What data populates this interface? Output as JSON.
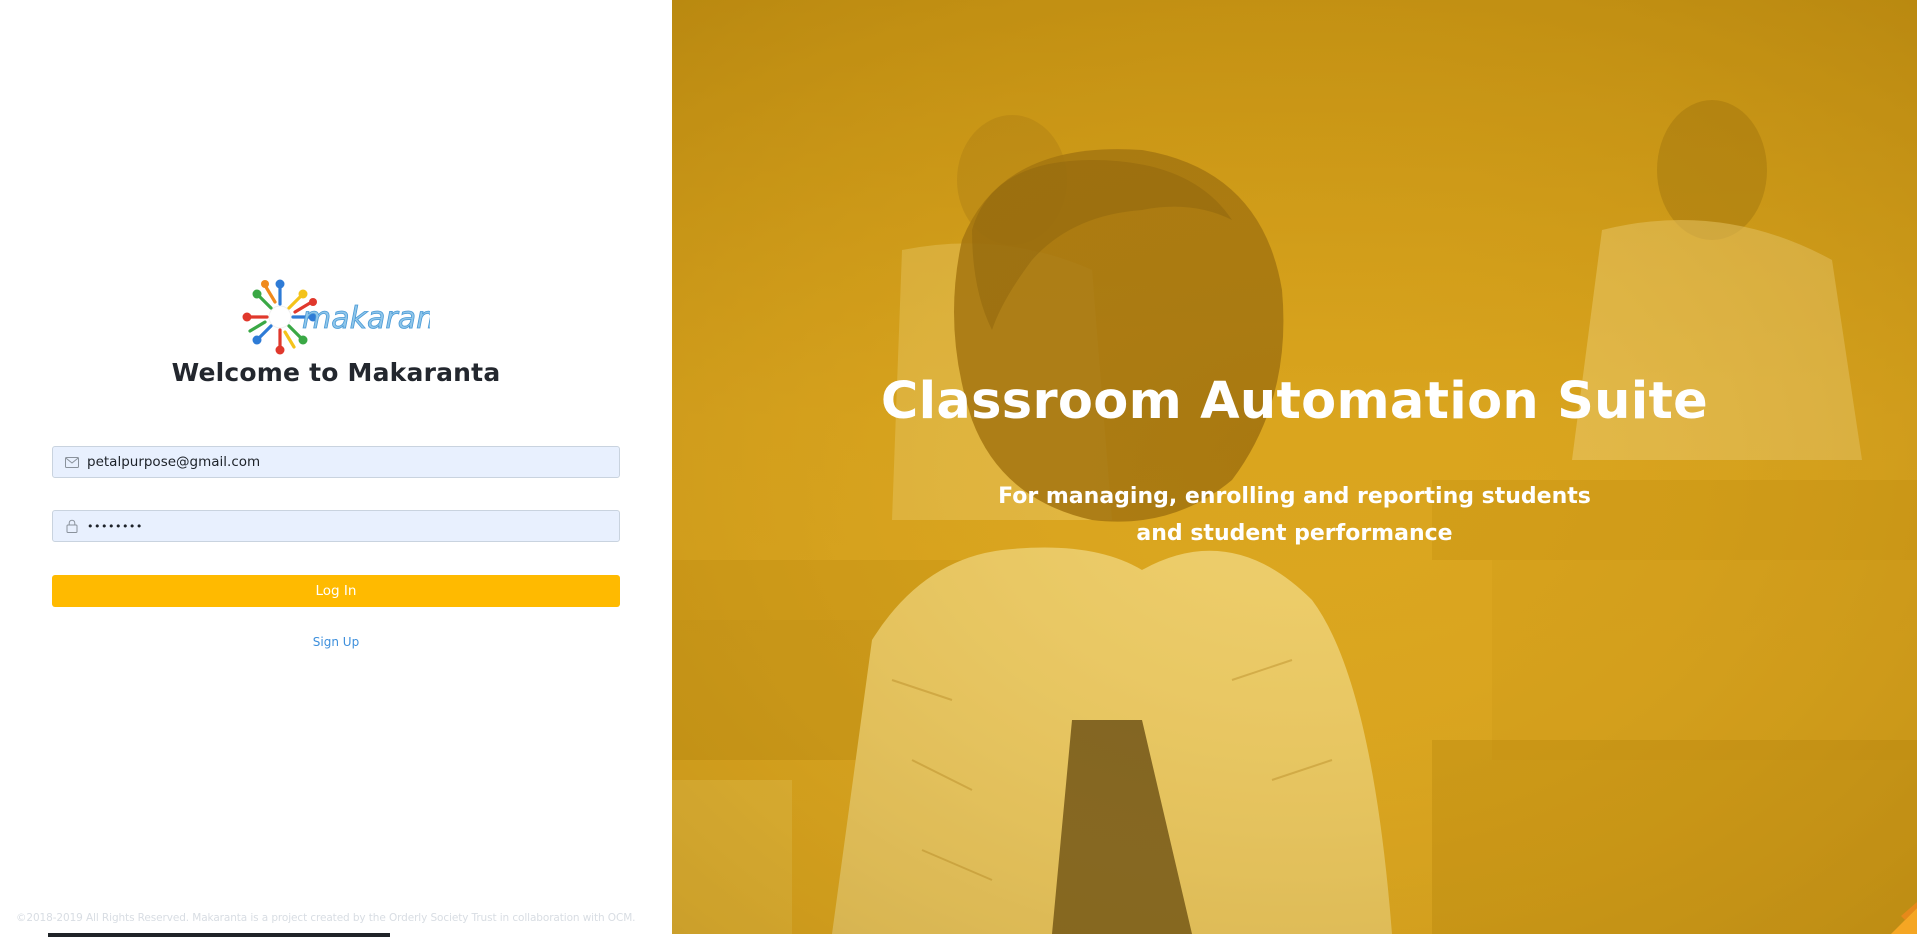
{
  "brand": {
    "logo_text": "makaranta",
    "welcome_title": "Welcome to Makaranta"
  },
  "login_form": {
    "email_value": "petalpurpose@gmail.com",
    "password_value": "••••••••",
    "email_icon": "mail-icon",
    "password_icon": "lock-icon",
    "login_label": "Log In",
    "signup_label": "Sign Up"
  },
  "footer": {
    "text": "©2018-2019 All Rights Reserved. Makaranta is a project created by the Orderly Society Trust in collaboration with OCM."
  },
  "hero": {
    "title": "Classroom Automation Suite",
    "subtitle_line1": "For managing, enrolling and reporting students",
    "subtitle_line2": "and student performance"
  },
  "colors": {
    "accent": "#ffba00",
    "hero_overlay": "#e0a91c",
    "link": "#3d8fdc",
    "title_text": "#23272e"
  }
}
